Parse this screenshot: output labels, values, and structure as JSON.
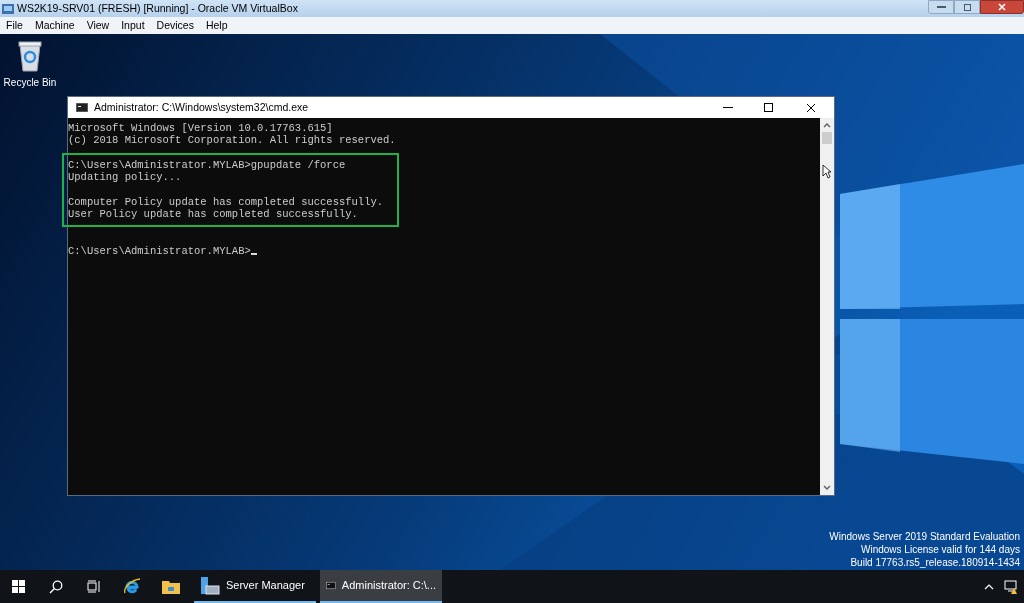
{
  "vbox": {
    "title": "WS2K19-SRV01 (FRESH) [Running] - Oracle VM VirtualBox",
    "menu": [
      "File",
      "Machine",
      "View",
      "Input",
      "Devices",
      "Help"
    ]
  },
  "desktop": {
    "icons": [
      {
        "label": "Recycle Bin"
      }
    ],
    "edition_lines": [
      "Windows Server 2019 Standard Evaluation",
      "Windows License valid for 144 days",
      "Build 17763.rs5_release.180914-1434"
    ]
  },
  "console_window": {
    "title": "Administrator: C:\\Windows\\system32\\cmd.exe",
    "cursor": true,
    "blocks": [
      {
        "highlighted": false,
        "paragraphs": [
          [
            "Microsoft Windows [Version 10.0.17763.615]",
            "(c) 2018 Microsoft Corporation. All rights reserved."
          ]
        ]
      },
      {
        "highlighted": true,
        "paragraphs": [
          [
            "C:\\Users\\Administrator.MYLAB>gpupdate /force",
            "Updating policy..."
          ],
          [
            "Computer Policy update has completed successfully.",
            "User Policy update has completed successfully."
          ]
        ]
      },
      {
        "highlighted": false,
        "paragraphs": [
          [
            "C:\\Users\\Administrator.MYLAB>"
          ]
        ]
      }
    ]
  },
  "taskbar": {
    "tasks": [
      {
        "kind": "server-manager",
        "label": "Server Manager",
        "selected": false
      },
      {
        "kind": "console",
        "label": "Administrator: C:\\...",
        "selected": true
      }
    ]
  }
}
